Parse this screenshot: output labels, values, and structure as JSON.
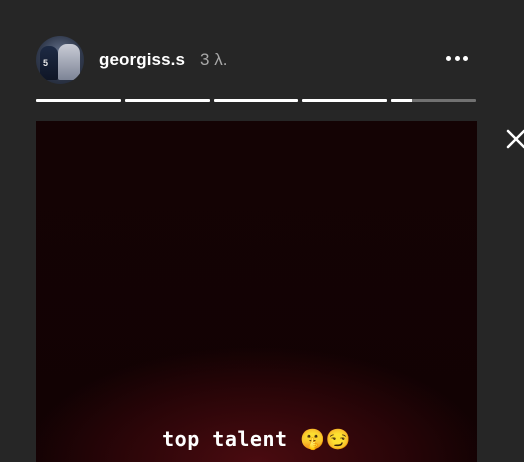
{
  "header": {
    "username": "georgiss.s",
    "time_ago": "3 λ.",
    "avatar_number": "5"
  },
  "icons": {
    "more": "more-horizontal-icon",
    "close": "close-icon"
  },
  "progress": {
    "segments": [
      1,
      1,
      1,
      1,
      0.25
    ]
  },
  "story": {
    "caption": "top talent 🤫😏"
  },
  "colors": {
    "background": "#262626",
    "story_bg": "#120203",
    "story_glow": "#4a0b10",
    "text_primary": "#ffffff",
    "text_secondary": "#a8a8a8"
  }
}
